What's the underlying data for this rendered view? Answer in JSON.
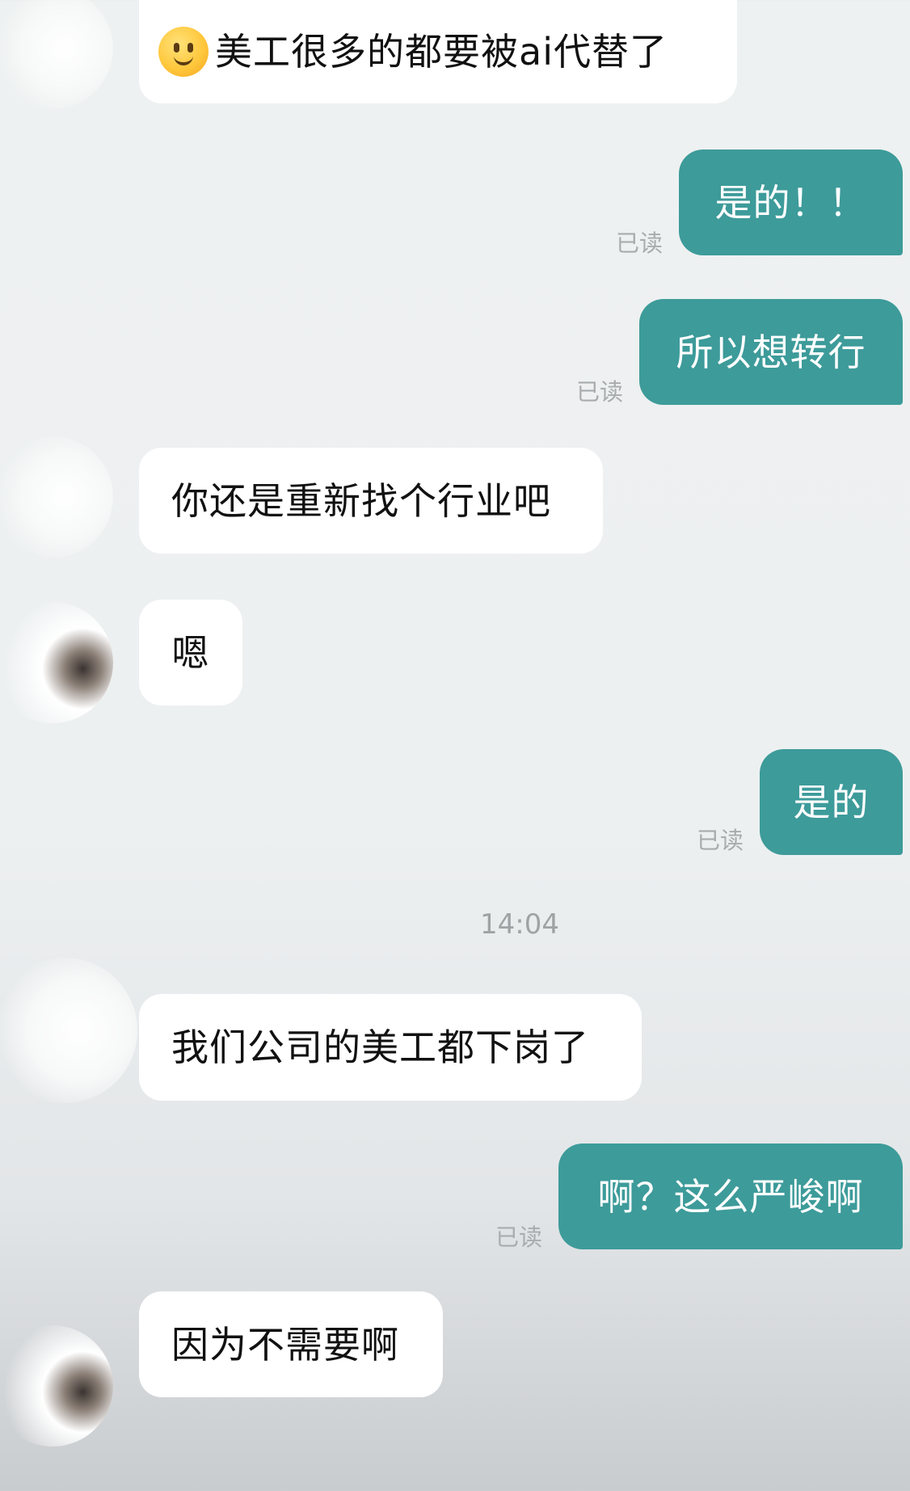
{
  "messages": [
    {
      "id": "m1",
      "side": "in",
      "text": "美工很多的都要被ai代替了",
      "emoji": "smile"
    },
    {
      "id": "m2",
      "side": "out",
      "text": "是的！！",
      "status": "已读"
    },
    {
      "id": "m3",
      "side": "out",
      "text": "所以想转行",
      "status": "已读"
    },
    {
      "id": "m4",
      "side": "in",
      "text": "你还是重新找个行业吧"
    },
    {
      "id": "m5",
      "side": "in",
      "text": "嗯"
    },
    {
      "id": "m6",
      "side": "out",
      "text": "是的",
      "status": "已读"
    },
    {
      "id": "m7",
      "side": "in",
      "text": "我们公司的美工都下岗了"
    },
    {
      "id": "m8",
      "side": "out",
      "text": "啊？这么严峻啊",
      "status": "已读"
    },
    {
      "id": "m9",
      "side": "in",
      "text": "因为不需要啊"
    }
  ],
  "timestamp": "14:04",
  "colors": {
    "outgoing_bubble": "#3d9b9a",
    "incoming_bubble": "#ffffff",
    "background": "#eef1f1"
  },
  "icons": {
    "m1_emoji": "smiling-face-emoji"
  }
}
